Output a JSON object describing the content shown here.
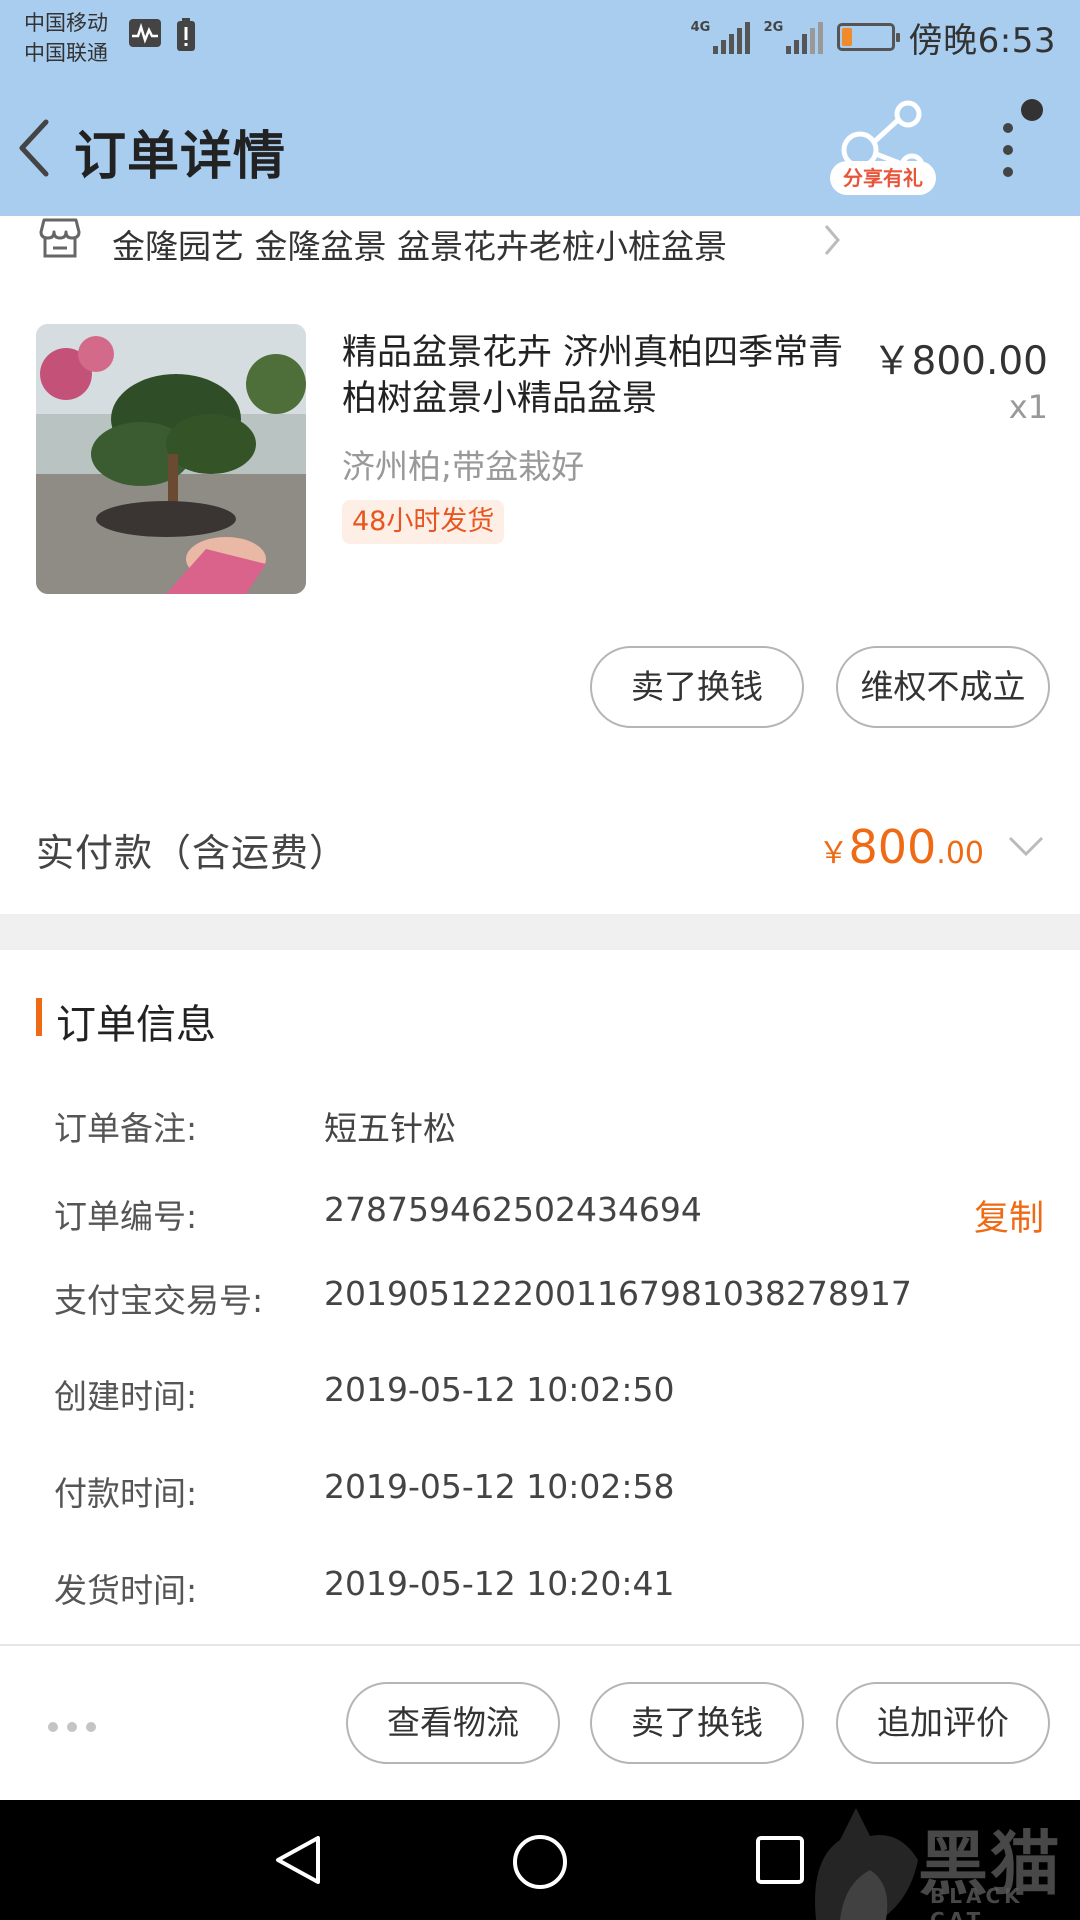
{
  "status_bar": {
    "carrier_1": "中国移动",
    "carrier_2": "中国联通",
    "net_1": "4G",
    "net_2": "2G",
    "time": "傍晚6:53",
    "battery_fill": 0.2,
    "battery_color": "#f08a2a"
  },
  "header": {
    "title": "订单详情",
    "share_label": "分享有礼",
    "bg_color": "#a9cdef"
  },
  "shop": {
    "name": "金隆园艺 金隆盆景  盆景花卉老桩小桩盆景",
    "icon": "store-icon"
  },
  "product": {
    "title": "精品盆景花卉 济州真柏四季常青 柏树盆景小精品盆景",
    "price": "￥800.00",
    "quantity": "x1",
    "sku": "济州柏;带盆栽好",
    "tag": "48小时发货",
    "image": "bonsai-photo"
  },
  "item_actions": {
    "sell": "卖了换钱",
    "dispute": "维权不成立"
  },
  "total": {
    "label": "实付款（含运费）",
    "currency": "￥",
    "integer": "800",
    "decimal": ".00",
    "accent_color": "#ef6a14"
  },
  "order_info": {
    "title": "订单信息",
    "rows": [
      {
        "label": "订单备注:",
        "value": "短五针松"
      },
      {
        "label": "订单编号:",
        "value": "2787594625024346​94"
      },
      {
        "label": "支付宝交易号:",
        "value": "2019051222001167981038278917"
      },
      {
        "label": "创建时间:",
        "value": "2019-05-12 10:02:50"
      },
      {
        "label": "付款时间:",
        "value": "2019-05-12 10:02:58"
      },
      {
        "label": "发货时间:",
        "value": "2019-05-12 10:20:41"
      }
    ],
    "copy_label": "复制"
  },
  "bottom_actions": {
    "logistics": "查看物流",
    "sell": "卖了换钱",
    "review": "追加评价"
  },
  "watermark": {
    "text": "黑猫",
    "sub": "BLACK CAT"
  }
}
